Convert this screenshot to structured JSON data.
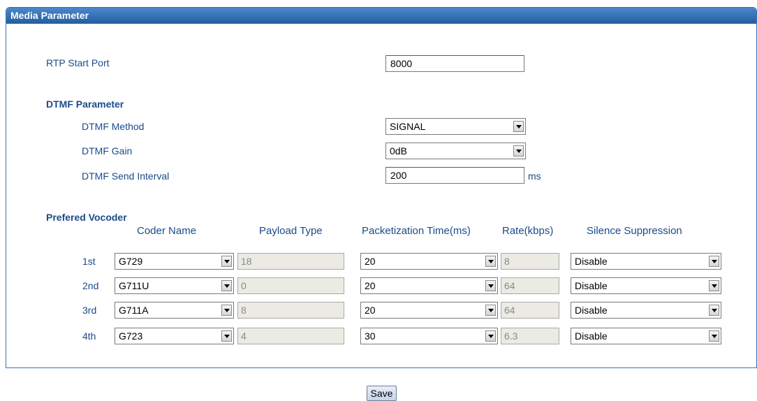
{
  "panel": {
    "title": "Media Parameter"
  },
  "rtp": {
    "label": "RTP Start Port",
    "value": "8000"
  },
  "dtmf": {
    "section_title": "DTMF Parameter",
    "method_label": "DTMF Method",
    "method_value": "SIGNAL",
    "gain_label": "DTMF Gain",
    "gain_value": "0dB",
    "interval_label": "DTMF Send Interval",
    "interval_value": "200",
    "interval_unit": "ms"
  },
  "vocoder": {
    "section_title": "Prefered Vocoder",
    "headers": {
      "coder_name": "Coder Name",
      "payload_type": "Payload Type",
      "packet_time": "Packetization Time(ms)",
      "rate": "Rate(kbps)",
      "silence": "Silence Suppression"
    },
    "rows": [
      {
        "label": "1st",
        "coder": "G729",
        "payload": "18",
        "ptime": "20",
        "rate": "8",
        "silence": "Disable"
      },
      {
        "label": "2nd",
        "coder": "G711U",
        "payload": "0",
        "ptime": "20",
        "rate": "64",
        "silence": "Disable"
      },
      {
        "label": "3rd",
        "coder": "G711A",
        "payload": "8",
        "ptime": "20",
        "rate": "64",
        "silence": "Disable"
      },
      {
        "label": "4th",
        "coder": "G723",
        "payload": "4",
        "ptime": "30",
        "rate": "6.3",
        "silence": "Disable"
      }
    ]
  },
  "save_label": "Save"
}
